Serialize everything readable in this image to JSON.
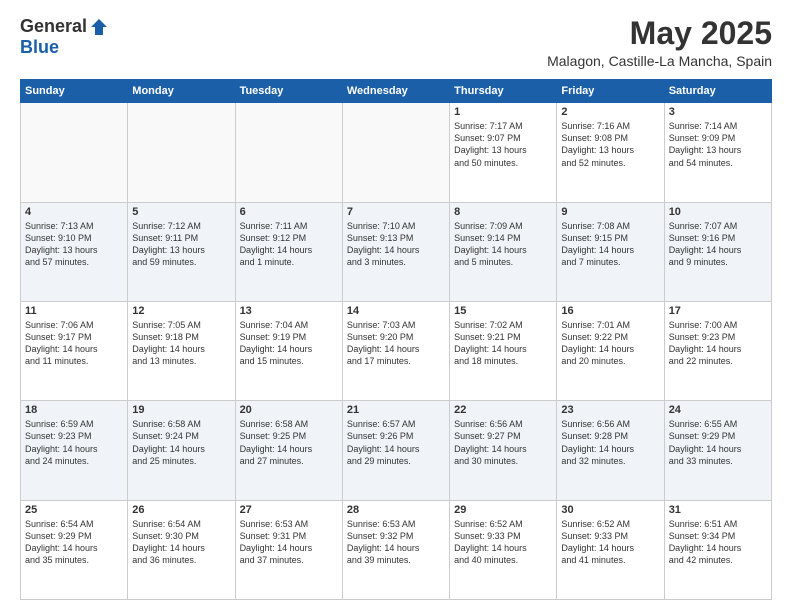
{
  "logo": {
    "general": "General",
    "blue": "Blue"
  },
  "title": "May 2025",
  "location": "Malagon, Castille-La Mancha, Spain",
  "days_of_week": [
    "Sunday",
    "Monday",
    "Tuesday",
    "Wednesday",
    "Thursday",
    "Friday",
    "Saturday"
  ],
  "weeks": [
    [
      {
        "day": "",
        "content": ""
      },
      {
        "day": "",
        "content": ""
      },
      {
        "day": "",
        "content": ""
      },
      {
        "day": "",
        "content": ""
      },
      {
        "day": "1",
        "content": "Sunrise: 7:17 AM\nSunset: 9:07 PM\nDaylight: 13 hours\nand 50 minutes."
      },
      {
        "day": "2",
        "content": "Sunrise: 7:16 AM\nSunset: 9:08 PM\nDaylight: 13 hours\nand 52 minutes."
      },
      {
        "day": "3",
        "content": "Sunrise: 7:14 AM\nSunset: 9:09 PM\nDaylight: 13 hours\nand 54 minutes."
      }
    ],
    [
      {
        "day": "4",
        "content": "Sunrise: 7:13 AM\nSunset: 9:10 PM\nDaylight: 13 hours\nand 57 minutes."
      },
      {
        "day": "5",
        "content": "Sunrise: 7:12 AM\nSunset: 9:11 PM\nDaylight: 13 hours\nand 59 minutes."
      },
      {
        "day": "6",
        "content": "Sunrise: 7:11 AM\nSunset: 9:12 PM\nDaylight: 14 hours\nand 1 minute."
      },
      {
        "day": "7",
        "content": "Sunrise: 7:10 AM\nSunset: 9:13 PM\nDaylight: 14 hours\nand 3 minutes."
      },
      {
        "day": "8",
        "content": "Sunrise: 7:09 AM\nSunset: 9:14 PM\nDaylight: 14 hours\nand 5 minutes."
      },
      {
        "day": "9",
        "content": "Sunrise: 7:08 AM\nSunset: 9:15 PM\nDaylight: 14 hours\nand 7 minutes."
      },
      {
        "day": "10",
        "content": "Sunrise: 7:07 AM\nSunset: 9:16 PM\nDaylight: 14 hours\nand 9 minutes."
      }
    ],
    [
      {
        "day": "11",
        "content": "Sunrise: 7:06 AM\nSunset: 9:17 PM\nDaylight: 14 hours\nand 11 minutes."
      },
      {
        "day": "12",
        "content": "Sunrise: 7:05 AM\nSunset: 9:18 PM\nDaylight: 14 hours\nand 13 minutes."
      },
      {
        "day": "13",
        "content": "Sunrise: 7:04 AM\nSunset: 9:19 PM\nDaylight: 14 hours\nand 15 minutes."
      },
      {
        "day": "14",
        "content": "Sunrise: 7:03 AM\nSunset: 9:20 PM\nDaylight: 14 hours\nand 17 minutes."
      },
      {
        "day": "15",
        "content": "Sunrise: 7:02 AM\nSunset: 9:21 PM\nDaylight: 14 hours\nand 18 minutes."
      },
      {
        "day": "16",
        "content": "Sunrise: 7:01 AM\nSunset: 9:22 PM\nDaylight: 14 hours\nand 20 minutes."
      },
      {
        "day": "17",
        "content": "Sunrise: 7:00 AM\nSunset: 9:23 PM\nDaylight: 14 hours\nand 22 minutes."
      }
    ],
    [
      {
        "day": "18",
        "content": "Sunrise: 6:59 AM\nSunset: 9:23 PM\nDaylight: 14 hours\nand 24 minutes."
      },
      {
        "day": "19",
        "content": "Sunrise: 6:58 AM\nSunset: 9:24 PM\nDaylight: 14 hours\nand 25 minutes."
      },
      {
        "day": "20",
        "content": "Sunrise: 6:58 AM\nSunset: 9:25 PM\nDaylight: 14 hours\nand 27 minutes."
      },
      {
        "day": "21",
        "content": "Sunrise: 6:57 AM\nSunset: 9:26 PM\nDaylight: 14 hours\nand 29 minutes."
      },
      {
        "day": "22",
        "content": "Sunrise: 6:56 AM\nSunset: 9:27 PM\nDaylight: 14 hours\nand 30 minutes."
      },
      {
        "day": "23",
        "content": "Sunrise: 6:56 AM\nSunset: 9:28 PM\nDaylight: 14 hours\nand 32 minutes."
      },
      {
        "day": "24",
        "content": "Sunrise: 6:55 AM\nSunset: 9:29 PM\nDaylight: 14 hours\nand 33 minutes."
      }
    ],
    [
      {
        "day": "25",
        "content": "Sunrise: 6:54 AM\nSunset: 9:29 PM\nDaylight: 14 hours\nand 35 minutes."
      },
      {
        "day": "26",
        "content": "Sunrise: 6:54 AM\nSunset: 9:30 PM\nDaylight: 14 hours\nand 36 minutes."
      },
      {
        "day": "27",
        "content": "Sunrise: 6:53 AM\nSunset: 9:31 PM\nDaylight: 14 hours\nand 37 minutes."
      },
      {
        "day": "28",
        "content": "Sunrise: 6:53 AM\nSunset: 9:32 PM\nDaylight: 14 hours\nand 39 minutes."
      },
      {
        "day": "29",
        "content": "Sunrise: 6:52 AM\nSunset: 9:33 PM\nDaylight: 14 hours\nand 40 minutes."
      },
      {
        "day": "30",
        "content": "Sunrise: 6:52 AM\nSunset: 9:33 PM\nDaylight: 14 hours\nand 41 minutes."
      },
      {
        "day": "31",
        "content": "Sunrise: 6:51 AM\nSunset: 9:34 PM\nDaylight: 14 hours\nand 42 minutes."
      }
    ]
  ]
}
